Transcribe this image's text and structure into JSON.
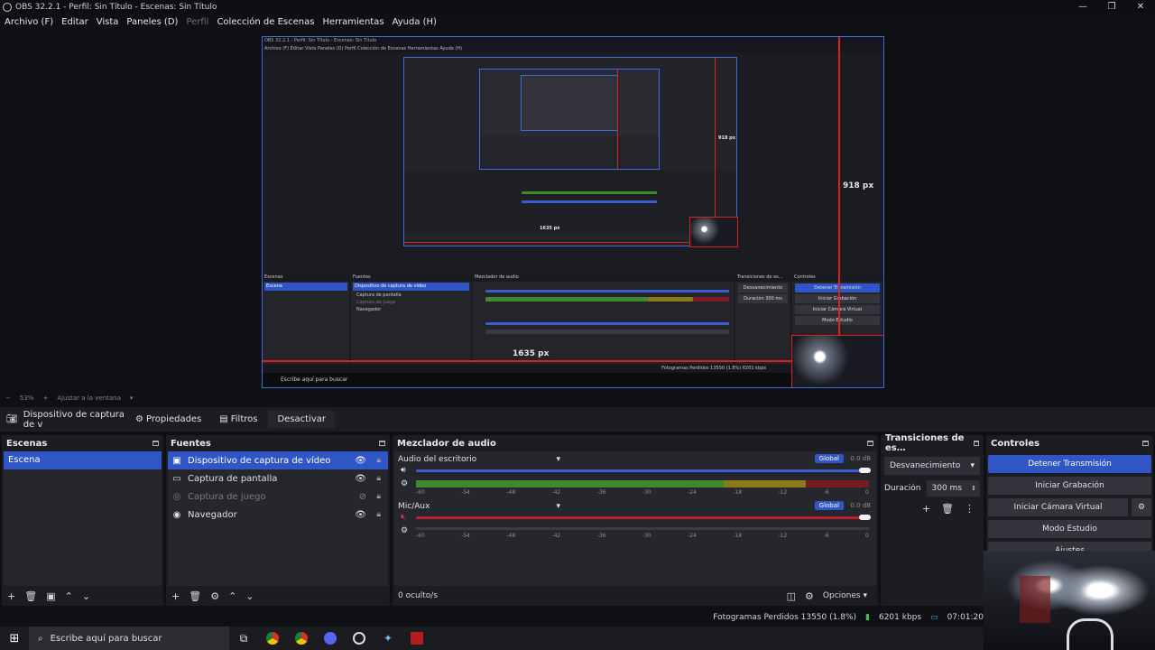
{
  "window": {
    "title": "OBS 32.2.1 - Perfil: Sin Título - Escenas: Sin Título",
    "controls": [
      "—",
      "❐",
      "✕"
    ]
  },
  "menu": [
    "Archivo (F)",
    "Editar",
    "Vista",
    "Paneles (D)",
    "Perfil",
    "Colección de Escenas",
    "Herramientas",
    "Ayuda (H)"
  ],
  "preview": {
    "inner_title": "OBS 32.2.1 - Perfil: Sin Título - Escenas: Sin Título",
    "height_label": "918 px",
    "inner_height_label": "918 px",
    "width_label": "1635 px",
    "inner_width_label": "1635 px",
    "mini_status": "Fotogramas Perdidos 13550 (1.8%)   6201 kbps",
    "mini_search": "Escribe aquí para buscar",
    "mini_controls": [
      "Detener Transmisión",
      "Iniciar Grabación",
      "Iniciar Cámara Virtual",
      "Modo Estudio"
    ]
  },
  "zoom": {
    "minus": "−",
    "level": "53%",
    "plus": "+",
    "fit_label": "Ajustar a la ventana"
  },
  "source_toolbar": {
    "current_source": "Dispositivo de captura de v",
    "properties": "Propiedades",
    "filters": "Filtros",
    "deactivate": "Desactivar"
  },
  "scenes": {
    "title": "Escenas",
    "items": [
      "Escena"
    ]
  },
  "sources": {
    "title": "Fuentes",
    "items": [
      {
        "label": "Dispositivo de captura de vídeo",
        "icon": "camera-icon",
        "visible": true
      },
      {
        "label": "Captura de pantalla",
        "icon": "monitor-icon",
        "visible": true
      },
      {
        "label": "Captura de juego",
        "icon": "gamepad-icon",
        "visible": false
      },
      {
        "label": "Navegador",
        "icon": "globe-icon",
        "visible": true
      }
    ]
  },
  "mixer": {
    "title": "Mezclador de audio",
    "hidden_count": "0 oculto/s",
    "options": "Opciones",
    "channels": [
      {
        "name": "Audio del escritorio",
        "tag": "Global",
        "db": "0.0 dB",
        "muted": false,
        "level_green": 0.68,
        "level_yellow": 0.18,
        "level_red": 0.14
      },
      {
        "name": "Mic/Aux",
        "tag": "Global",
        "db": "0.0 dB",
        "muted": true,
        "level_green": 0,
        "level_yellow": 0,
        "level_red": 0
      }
    ],
    "ticks": [
      "-60",
      "-54",
      "-48",
      "-42",
      "-36",
      "-30",
      "-24",
      "-18",
      "-12",
      "-6",
      "0"
    ]
  },
  "transitions": {
    "title": "Transiciones de es…",
    "selected": "Desvanecimiento",
    "duration_label": "Duración",
    "duration_value": "300 ms"
  },
  "controls": {
    "title": "Controles",
    "stop_stream": "Detener Transmisión",
    "start_recording": "Iniciar Grabación",
    "start_virtualcam": "Iniciar Cámara Virtual",
    "studio_mode": "Modo Estudio",
    "settings": "Ajustes"
  },
  "status": {
    "dropped_frames": "Fotogramas Perdidos 13550 (1.8%)",
    "bitrate": "6201 kbps",
    "time": "07:01:20"
  },
  "taskbar": {
    "search_placeholder": "Escribe aquí para buscar"
  },
  "colors": {
    "accent": "#2f56c4",
    "redline": "#e02020",
    "meter_green": "#3c8a2a",
    "meter_yellow": "#8a7a1a",
    "meter_red": "#7a1a24"
  }
}
